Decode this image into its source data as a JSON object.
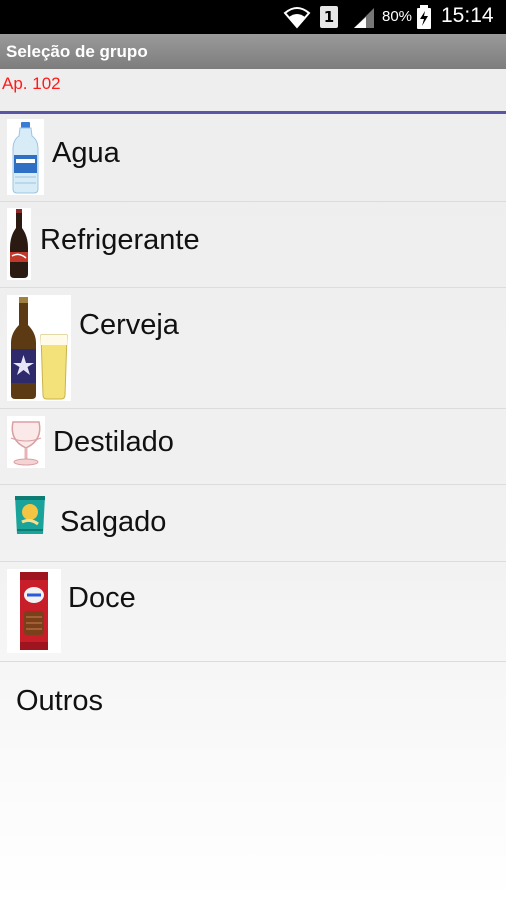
{
  "status_bar": {
    "sim_slot": "1",
    "battery": "80%",
    "time": "15:14",
    "icons": [
      "wifi-icon",
      "sim-1-icon",
      "signal-icon",
      "battery-charging-icon"
    ]
  },
  "app": {
    "title": "Seleção de grupo",
    "apartment": "Ap. 102",
    "accent_color": "#5a56a6",
    "apartment_color": "#ff1a1a"
  },
  "groups": [
    {
      "label": "Agua",
      "icon": "water-bottle-icon"
    },
    {
      "label": "Refrigerante",
      "icon": "soda-bottle-icon"
    },
    {
      "label": "Cerveja",
      "icon": "beer-bottle-glass-icon"
    },
    {
      "label": "Destilado",
      "icon": "cognac-glass-icon"
    },
    {
      "label": "Salgado",
      "icon": "snack-bag-icon"
    },
    {
      "label": "Doce",
      "icon": "candy-bar-icon"
    },
    {
      "label": "Outros",
      "icon": ""
    }
  ]
}
